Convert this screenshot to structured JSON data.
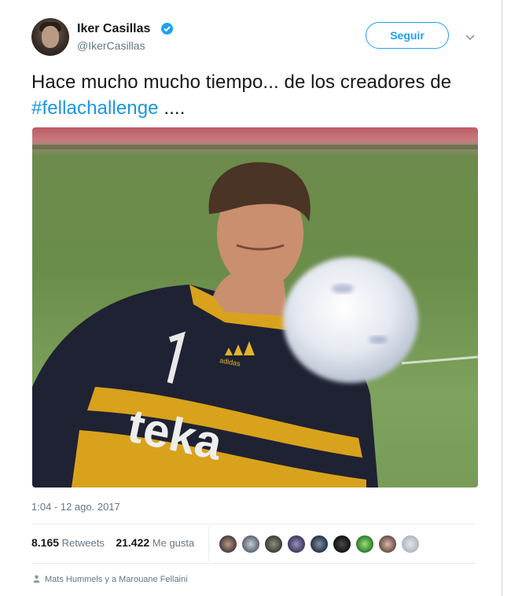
{
  "tweet": {
    "author_name": "Iker Casillas",
    "author_handle": "@IkerCasillas",
    "follow_label": "Seguir",
    "text_before": "Hace mucho mucho tiempo... de los creadores de ",
    "hashtag": "#fellachallenge",
    "text_after": " ....",
    "timestamp": "1:04 - 12 ago. 2017",
    "retweets_count": "8.165",
    "retweets_label": "Retweets",
    "likes_count": "21.422",
    "likes_label": "Me gusta",
    "mentions": "Mats Hummels y a Marouane Fellaini"
  },
  "photo": {
    "shirt_number": "1",
    "sponsor": "teka",
    "kit_brand": "adidas"
  },
  "colors": {
    "accent": "#1da1f2",
    "hashtag": "#1b95e0",
    "muted": "#657786",
    "text": "#14171a"
  }
}
